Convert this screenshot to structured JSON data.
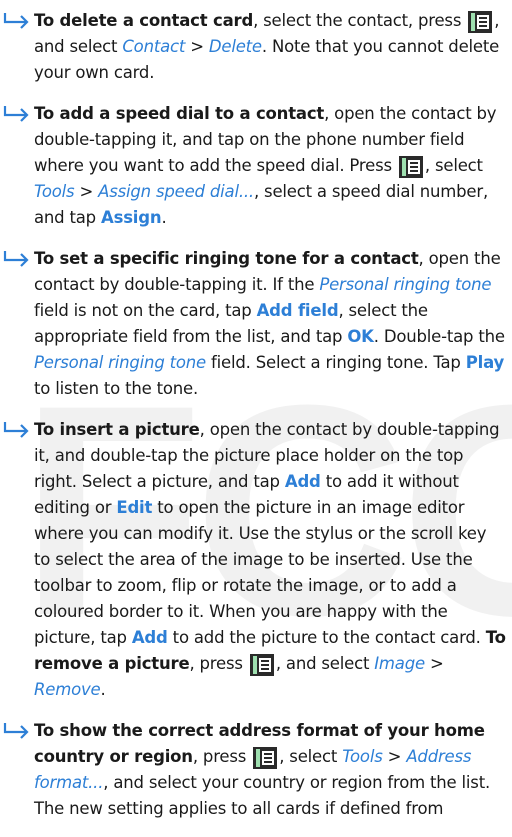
{
  "icons": {
    "arrow": "right-arrow-icon",
    "menu": "menu-key-icon"
  },
  "colors": {
    "accent": "#2d7fd6",
    "text": "#1a1a1a"
  },
  "watermark": "FCC",
  "items": [
    {
      "t0": "To delete a contact card",
      "t1": ", select the contact, press ",
      "t2": ", and select ",
      "t3": "Contact",
      "t4": " > ",
      "t5": "Delete",
      "t6": ". Note that you cannot delete your own card."
    },
    {
      "t0": "To add a speed dial to a contact",
      "t1": ", open the contact by double-tapping it, and tap on the phone number field where you want to add the speed dial. Press ",
      "t2": ", select ",
      "t3": "Tools",
      "t4": " > ",
      "t5": "Assign speed dial...",
      "t6": ", select a speed dial number, and tap ",
      "t7": "Assign",
      "t8": "."
    },
    {
      "t0": "To set a specific ringing tone for a contact",
      "t1": ", open the contact by double-tapping it. If the ",
      "t2": "Personal ringing tone",
      "t3": " field is not on the card, tap ",
      "t4": "Add field",
      "t5": ", select the appropriate field from the list, and tap ",
      "t6": "OK",
      "t7": ". Double-tap the ",
      "t8": "Personal ringing tone",
      "t9": " field. Select a ringing tone. Tap ",
      "t10": "Play",
      "t11": " to listen to the tone."
    },
    {
      "t0": "To insert a picture",
      "t1": ", open the contact by double-tapping it, and double-tap the picture place holder on the top right. Select a picture, and tap ",
      "t2": "Add",
      "t3": " to add it without editing or ",
      "t4": "Edit",
      "t5": " to open the picture in an image editor where you can modify it. Use the stylus or the scroll key to select the area of the image to be inserted. Use the toolbar to zoom, flip or rotate the image, or to add a coloured border to it. When you are happy with the picture, tap ",
      "t6": "Add",
      "t7": " to add the picture to the contact card. ",
      "t8": "To remove a picture",
      "t9": ", press ",
      "t10": ", and select ",
      "t11": "Image",
      "t12": " > ",
      "t13": "Remove",
      "t14": "."
    },
    {
      "t0": "To show the correct address format of your home country or region",
      "t1": ", press ",
      "t2": ", select ",
      "t3": "Tools",
      "t4": " > ",
      "t5": "Address format...",
      "t6": ", and select your country or region from the list. The new setting applies to all cards if defined from"
    }
  ]
}
